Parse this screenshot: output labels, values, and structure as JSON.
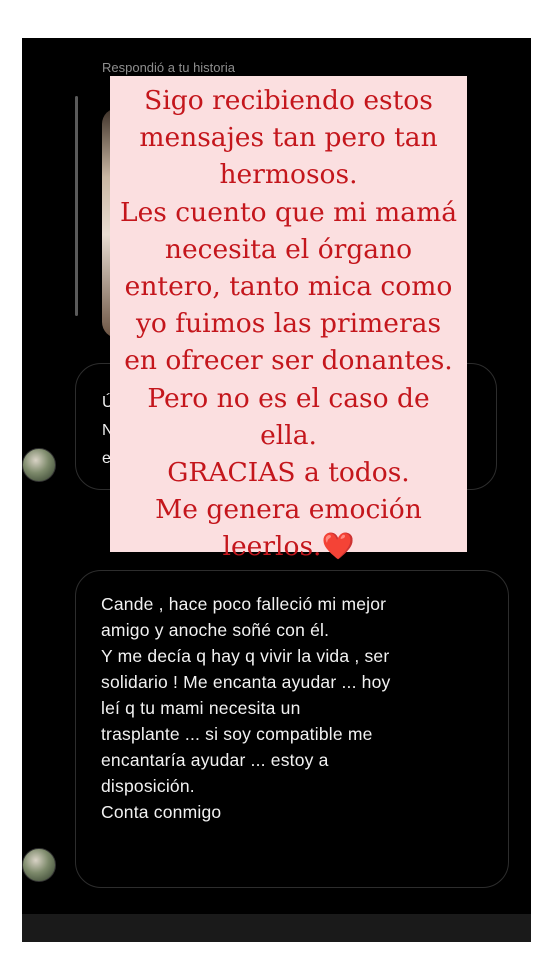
{
  "story_reply": {
    "label": "Respondió a tu historia"
  },
  "overlay": {
    "text": "Sigo recibiendo estos\nmensajes tan pero tan\nhermosos.\nLes cuento que mi mamá\nnecesita el órgano\nentero, tanto mica como\nyo fuimos las primeras\nen ofrecer ser donantes.\nPero no es el caso de\nella.\nGRACIAS a todos.\nMe genera emoción\nleerlos.❤️",
    "color": "#c4161c",
    "background": "#fbdfe0"
  },
  "messages": [
    {
      "visible_fragments": [
        "Ú",
        "N",
        "e"
      ]
    },
    {
      "text": "Cande , hace poco falleció mi mejor\namigo y anoche soñé con él.\nY me decía q hay q vivir la vida , ser\nsolidario ! Me encanta ayudar ... hoy\nleí q tu mami necesita un\ntrasplante ... si soy compatible me\nencantaría ayudar ... estoy a\ndisposición.\nConta conmigo"
    }
  ]
}
